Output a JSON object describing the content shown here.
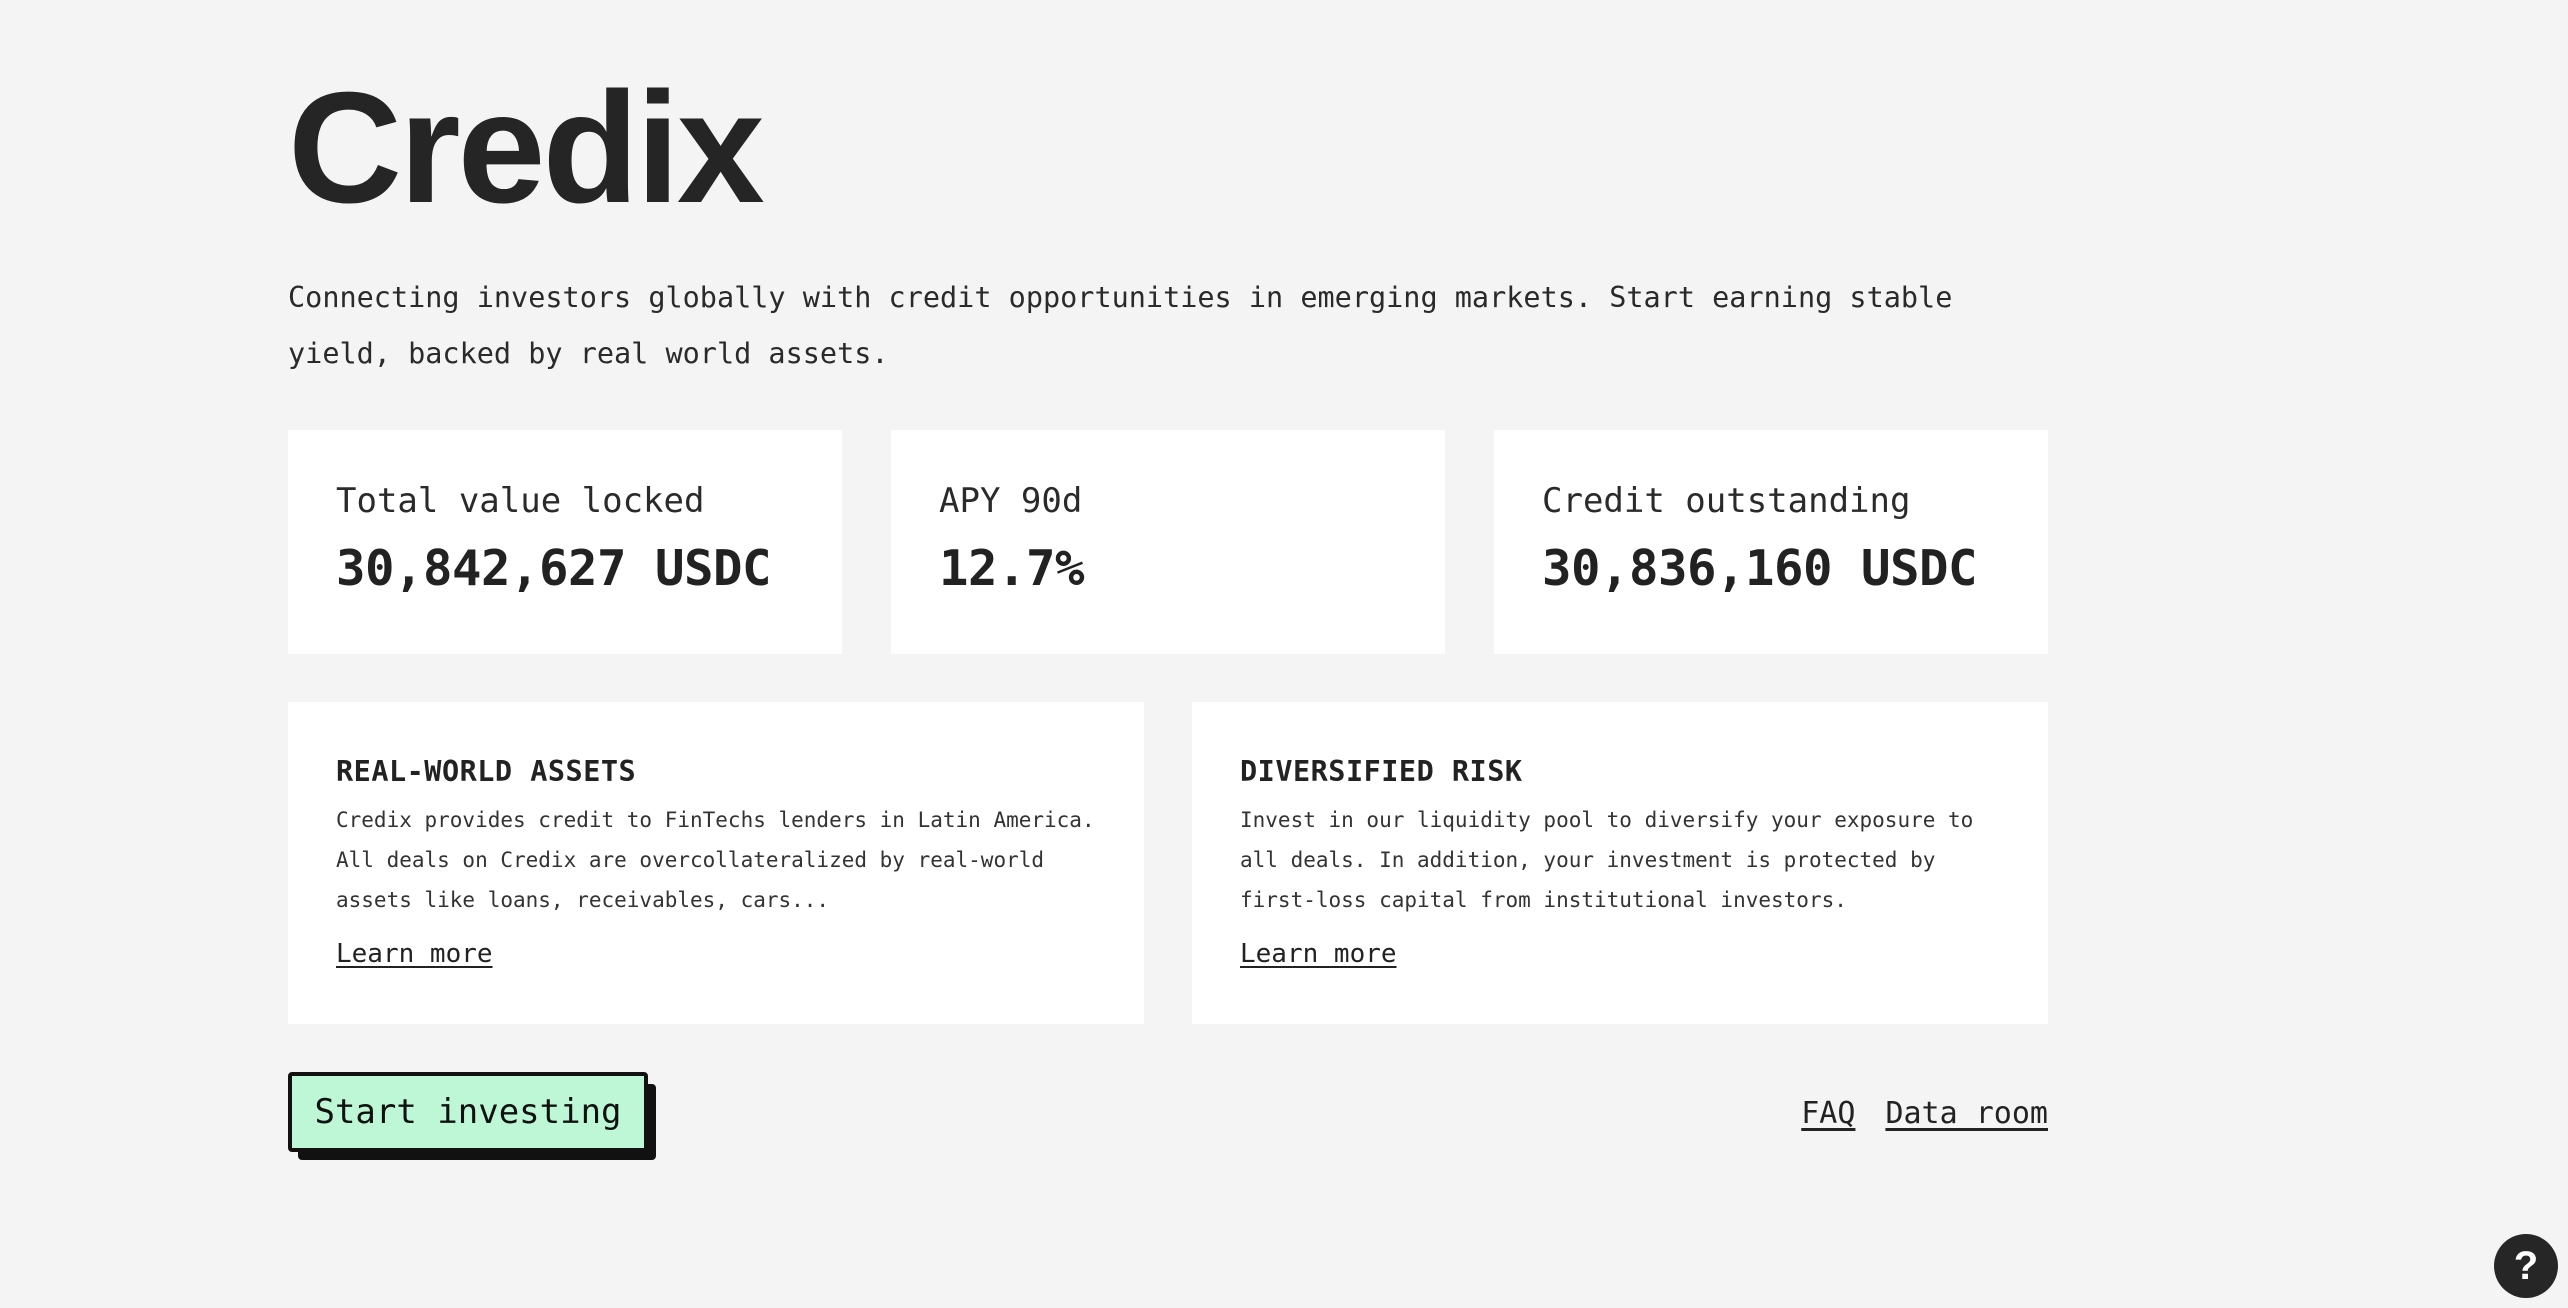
{
  "header": {
    "title": "Credix",
    "subtitle": "Connecting investors globally with credit opportunities in emerging markets. Start earning stable yield, backed by real world assets."
  },
  "stats": [
    {
      "label": "Total value locked",
      "value": "30,842,627 USDC"
    },
    {
      "label": "APY 90d",
      "value": "12.7%"
    },
    {
      "label": "Credit outstanding",
      "value": "30,836,160 USDC"
    }
  ],
  "features": [
    {
      "title": "REAL-WORLD ASSETS",
      "text": "Credix provides credit to FinTechs lenders in Latin America. All deals on Credix are overcollateralized by real-world assets like loans, receivables, cars...",
      "link": "Learn more"
    },
    {
      "title": "DIVERSIFIED RISK",
      "text": "Invest in our liquidity pool to diversify your exposure to all deals. In addition, your investment is protected by first-loss capital from institutional investors.",
      "link": "Learn more"
    }
  ],
  "actions": {
    "start_investing": "Start investing",
    "faq": "FAQ",
    "data_room": "Data room"
  },
  "help": {
    "icon": "question-mark-icon",
    "glyph": "?"
  },
  "colors": {
    "background": "#f4f4f4",
    "card": "#ffffff",
    "cta_fill": "#bdf7d6",
    "text": "#222222"
  }
}
